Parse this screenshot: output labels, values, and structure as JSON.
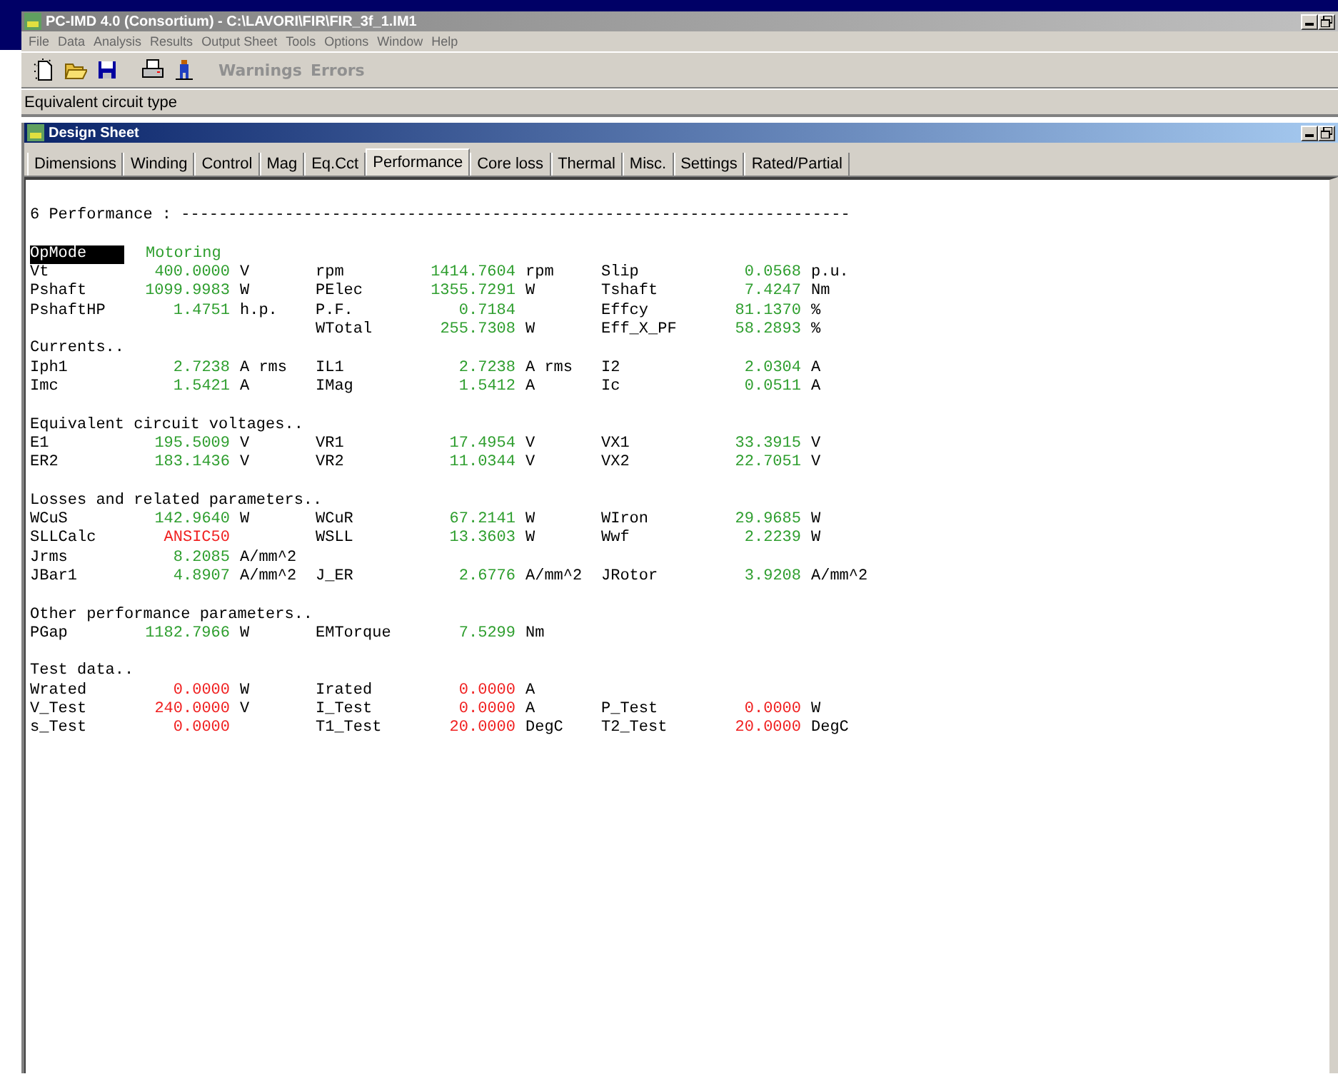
{
  "window": {
    "title": "PC-IMD 4.0 (Consortium) - C:\\LAVORI\\FIR\\FIR_3f_1.IM1",
    "active": false
  },
  "menu": [
    "File",
    "Data",
    "Analysis",
    "Results",
    "Output Sheet",
    "Tools",
    "Options",
    "Window",
    "Help"
  ],
  "toolbar": {
    "buttons": [
      {
        "kind": "new"
      },
      {
        "kind": "open"
      },
      {
        "kind": "save"
      },
      {
        "kind": "print"
      },
      {
        "kind": "figure"
      }
    ],
    "text_buttons": [
      {
        "label": "Warnings",
        "disabled": true
      },
      {
        "label": "Errors",
        "disabled": true
      }
    ]
  },
  "hint_bar": "Equivalent circuit type",
  "child_window": {
    "title": "Design Sheet",
    "tabs": [
      {
        "label": "Dimensions",
        "selected": false
      },
      {
        "label": "Winding",
        "selected": false
      },
      {
        "label": "Control",
        "selected": false
      },
      {
        "label": "Mag",
        "selected": false
      },
      {
        "label": "Eq.Cct",
        "selected": false
      },
      {
        "label": "Performance",
        "selected": true
      },
      {
        "label": "Core loss",
        "selected": false
      },
      {
        "label": "Thermal",
        "selected": false
      },
      {
        "label": "Misc.",
        "selected": false
      },
      {
        "label": "Settings",
        "selected": false
      },
      {
        "label": "Rated/Partial",
        "selected": false
      }
    ]
  },
  "sheet": {
    "heading": "6 Performance : -----------------------------------------------------------------------",
    "op_mode": {
      "label": "OpMode",
      "value": "Motoring",
      "selected": true
    },
    "sections": [
      {
        "spaced": false,
        "rows": [
          [
            {
              "label": "Vt",
              "value": "400.0000",
              "unit": "V",
              "kind": "computed"
            },
            {
              "label": "rpm",
              "value": "1414.7604",
              "unit": "rpm",
              "kind": "computed"
            },
            {
              "label": "Slip",
              "value": "0.0568",
              "unit": "p.u.",
              "kind": "computed"
            }
          ],
          [
            {
              "label": "Pshaft",
              "value": "1099.9983",
              "unit": "W",
              "kind": "computed"
            },
            {
              "label": "PElec",
              "value": "1355.7291",
              "unit": "W",
              "kind": "computed"
            },
            {
              "label": "Tshaft",
              "value": "7.4247",
              "unit": "Nm",
              "kind": "computed"
            }
          ],
          [
            {
              "label": "PshaftHP",
              "value": "1.4751",
              "unit": "h.p.",
              "kind": "computed"
            },
            {
              "label": "P.F.",
              "value": "0.7184",
              "kind": "computed"
            },
            {
              "label": "Effcy",
              "value": "81.1370",
              "unit": "%",
              "kind": "computed"
            }
          ],
          [
            null,
            {
              "label": "WTotal",
              "value": "255.7308",
              "unit": "W",
              "kind": "computed"
            },
            {
              "label": "Eff_X_PF",
              "value": "58.2893",
              "unit": "%",
              "kind": "computed"
            }
          ]
        ]
      },
      {
        "title": "Currents..",
        "spaced": false,
        "rows": [
          [
            {
              "label": "Iph1",
              "value": "2.7238",
              "unit": "A rms",
              "kind": "computed"
            },
            {
              "label": "IL1",
              "value": "2.7238",
              "unit": "A rms",
              "kind": "computed"
            },
            {
              "label": "I2",
              "value": "2.0304",
              "unit": "A",
              "kind": "computed"
            }
          ],
          [
            {
              "label": "Imc",
              "value": "1.5421",
              "unit": "A",
              "kind": "computed"
            },
            {
              "label": "IMag",
              "value": "1.5412",
              "unit": "A",
              "kind": "computed"
            },
            {
              "label": "Ic",
              "value": "0.0511",
              "unit": "A",
              "kind": "computed"
            }
          ]
        ]
      },
      {
        "title": "Equivalent circuit voltages..",
        "spaced": true,
        "rows": [
          [
            {
              "label": "E1",
              "value": "195.5009",
              "unit": "V",
              "kind": "computed"
            },
            {
              "label": "VR1",
              "value": "17.4954",
              "unit": "V",
              "kind": "computed"
            },
            {
              "label": "VX1",
              "value": "33.3915",
              "unit": "V",
              "kind": "computed"
            }
          ],
          [
            {
              "label": "ER2",
              "value": "183.1436",
              "unit": "V",
              "kind": "computed"
            },
            {
              "label": "VR2",
              "value": "11.0344",
              "unit": "V",
              "kind": "computed"
            },
            {
              "label": "VX2",
              "value": "22.7051",
              "unit": "V",
              "kind": "computed"
            }
          ]
        ]
      },
      {
        "title": "Losses and related parameters..",
        "spaced": true,
        "rows": [
          [
            {
              "label": "WCuS",
              "value": "142.9640",
              "unit": "W",
              "kind": "computed"
            },
            {
              "label": "WCuR",
              "value": "67.2141",
              "unit": "W",
              "kind": "computed"
            },
            {
              "label": "WIron",
              "value": "29.9685",
              "unit": "W",
              "kind": "computed"
            }
          ],
          [
            {
              "label": "SLLCalc",
              "value": "ANSIC50",
              "kind": "input"
            },
            {
              "label": "WSLL",
              "value": "13.3603",
              "unit": "W",
              "kind": "computed"
            },
            {
              "label": "Wwf",
              "value": "2.2239",
              "unit": "W",
              "kind": "computed"
            }
          ],
          [
            {
              "label": "Jrms",
              "value": "8.2085",
              "unit": "A/mm^2",
              "kind": "computed"
            }
          ],
          [
            {
              "label": "JBar1",
              "value": "4.8907",
              "unit": "A/mm^2",
              "kind": "computed"
            },
            {
              "label": "J_ER",
              "value": "2.6776",
              "unit": "A/mm^2",
              "kind": "computed"
            },
            {
              "label": "JRotor",
              "value": "3.9208",
              "unit": "A/mm^2",
              "kind": "computed"
            }
          ]
        ]
      },
      {
        "title": "Other performance parameters..",
        "spaced": true,
        "rows": [
          [
            {
              "label": "PGap",
              "value": "1182.7966",
              "unit": "W",
              "kind": "computed"
            },
            {
              "label": "EMTorque",
              "value": "7.5299",
              "unit": "Nm",
              "kind": "computed"
            }
          ]
        ]
      },
      {
        "title": "Test data..",
        "spaced": true,
        "rows": [
          [
            {
              "label": "Wrated",
              "value": "0.0000",
              "unit": "W",
              "kind": "input"
            },
            {
              "label": "Irated",
              "value": "0.0000",
              "unit": "A",
              "kind": "input"
            }
          ],
          [
            {
              "label": "V_Test",
              "value": "240.0000",
              "unit": "V",
              "kind": "input"
            },
            {
              "label": "I_Test",
              "value": "0.0000",
              "unit": "A",
              "kind": "input"
            },
            {
              "label": "P_Test",
              "value": "0.0000",
              "unit": "W",
              "kind": "input"
            }
          ],
          [
            {
              "label": "s_Test",
              "value": "0.0000",
              "kind": "input"
            },
            {
              "label": "T1_Test",
              "value": "20.0000",
              "unit": "DegC",
              "kind": "input"
            },
            {
              "label": "T2_Test",
              "value": "20.0000",
              "unit": "DegC",
              "kind": "input"
            }
          ]
        ]
      }
    ]
  }
}
